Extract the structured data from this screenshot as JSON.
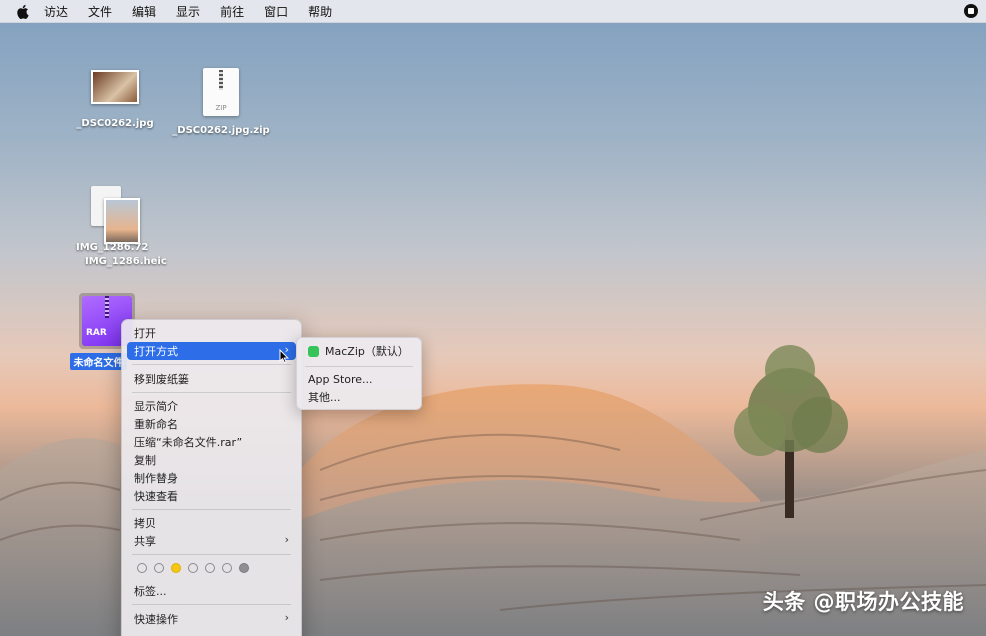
{
  "menubar": {
    "apple_icon": "apple-logo-icon",
    "items": [
      "访达",
      "文件",
      "编辑",
      "显示",
      "前往",
      "窗口",
      "帮助"
    ],
    "status_icon": "screen-record-stop-icon"
  },
  "desktop": {
    "icons": [
      {
        "label": "_DSC0262.jpg",
        "type": "photo"
      },
      {
        "label": "_DSC0262.jpg.zip",
        "type": "zip",
        "badge": "ZIP"
      },
      {
        "label_back": "IMG_1286.72",
        "label": "IMG_1286.heic",
        "type": "heic"
      },
      {
        "label": "未命名文件",
        "type": "rar",
        "badge": "RAR",
        "selected": true
      }
    ]
  },
  "context_menu": {
    "items": {
      "open": "打开",
      "open_with": "打开方式",
      "trash": "移到废纸篓",
      "get_info": "显示简介",
      "rename": "重新命名",
      "compress": "压缩“未命名文件.rar”",
      "duplicate": "复制",
      "make_alias": "制作替身",
      "quick_look": "快速查看",
      "copy": "拷贝",
      "share": "共享",
      "tags": "标签...",
      "quick_actions": "快速操作"
    },
    "tag_colors": [
      "none",
      "none",
      "#f5c518",
      "none",
      "none",
      "none",
      "#8e8e93"
    ]
  },
  "submenu": {
    "default_app": "MacZip（默认）",
    "app_store": "App Store...",
    "other": "其他..."
  },
  "watermark": "头条 @职场办公技能",
  "colors": {
    "highlight": "#2d6ee8",
    "maczip_green": "#35c35a",
    "rar_purple": "#7b2ff2"
  }
}
